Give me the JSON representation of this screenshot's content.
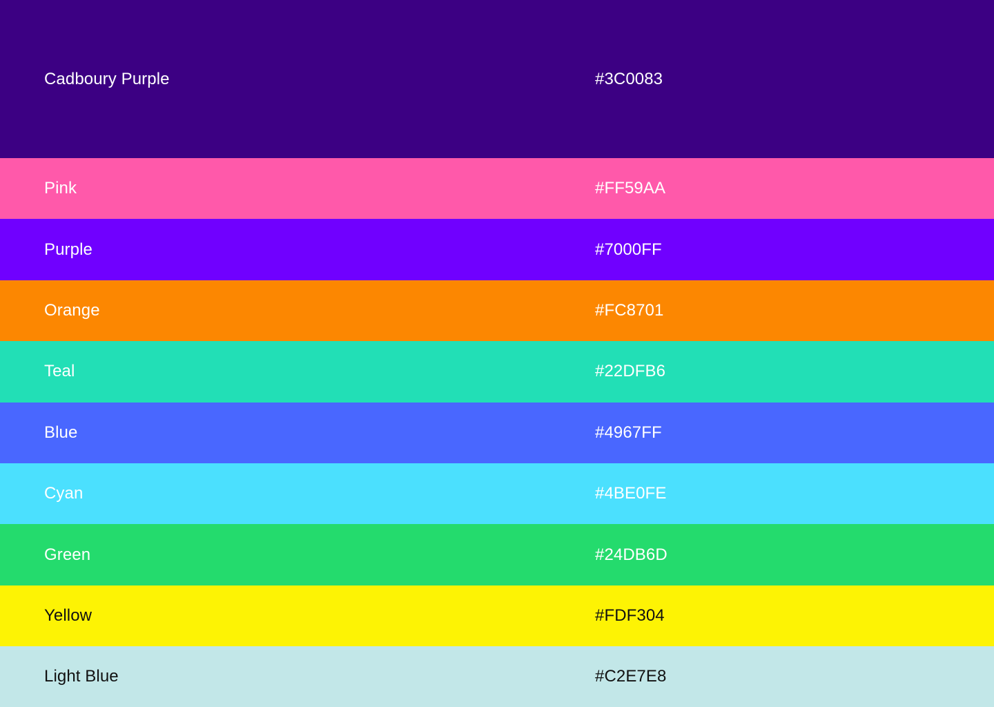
{
  "swatches": [
    {
      "name": "Cadboury Purple",
      "hex": "#3C0083",
      "color": "#3C0083",
      "text_color": "#FFFFFF"
    },
    {
      "name": "Pink",
      "hex": "#FF59AA",
      "color": "#FF59AA",
      "text_color": "#FFFFFF"
    },
    {
      "name": "Purple",
      "hex": "#7000FF",
      "color": "#7000FF",
      "text_color": "#FFFFFF"
    },
    {
      "name": "Orange",
      "hex": "#FC8701",
      "color": "#FC8701",
      "text_color": "#FFFFFF"
    },
    {
      "name": "Teal",
      "hex": "#22DFB6",
      "color": "#22DFB6",
      "text_color": "#FFFFFF"
    },
    {
      "name": "Blue",
      "hex": "#4967FF",
      "color": "#4967FF",
      "text_color": "#FFFFFF"
    },
    {
      "name": "Cyan",
      "hex": "#4BE0FE",
      "color": "#4BE0FE",
      "text_color": "#FFFFFF"
    },
    {
      "name": "Green",
      "hex": "#24DB6D",
      "color": "#24DB6D",
      "text_color": "#FFFFFF"
    },
    {
      "name": "Yellow",
      "hex": "#FDF304",
      "color": "#FDF304",
      "text_color": "#111111"
    },
    {
      "name": "Light Blue",
      "hex": "#C2E7E8",
      "color": "#C2E7E8",
      "text_color": "#111111"
    }
  ]
}
